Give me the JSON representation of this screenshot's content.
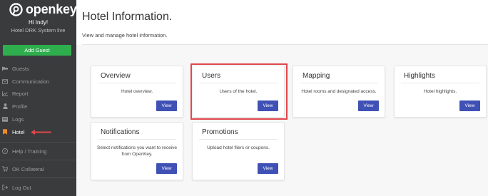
{
  "sidebar": {
    "logo_text": "openkey",
    "greeting": "Hi Indy!",
    "hotel_name": "Hotel DRK System live",
    "add_guest_label": "Add Guest",
    "items": [
      {
        "label": "Guests",
        "icon": "bed-icon"
      },
      {
        "label": "Communication",
        "icon": "envelope-icon"
      },
      {
        "label": "Report",
        "icon": "chart-icon"
      },
      {
        "label": "Profile",
        "icon": "user-icon"
      },
      {
        "label": "Logs",
        "icon": "list-icon"
      },
      {
        "label": "Hotel",
        "icon": "bookmark-icon",
        "active": true
      },
      {
        "label": "Help / Training",
        "icon": "question-icon"
      },
      {
        "label": "OK Collateral",
        "icon": "cart-icon"
      },
      {
        "label": "Log Out",
        "icon": "logout-icon"
      }
    ]
  },
  "main": {
    "title": "Hotel Information.",
    "subtitle": "View and manage hotel information."
  },
  "cards": [
    {
      "title": "Overview",
      "description": "Hotel overview.",
      "button": "View"
    },
    {
      "title": "Users",
      "description": "Users of the hotel.",
      "button": "View"
    },
    {
      "title": "Mapping",
      "description": "Hotel rooms and designated access.",
      "button": "View"
    },
    {
      "title": "Highlights",
      "description": "Hotel highlights.",
      "button": "View"
    },
    {
      "title": "Notifications",
      "description": "Select notifications you want to receive from OpenKey.",
      "button": "View"
    },
    {
      "title": "Promotions",
      "description": "Upload hotel fliers or coupons.",
      "button": "View"
    }
  ],
  "colors": {
    "sidebar_bg": "#3a3b3d",
    "add_guest": "#2fae4e",
    "view_button": "#3f51b5",
    "active_icon": "#f0892c",
    "annotation": "#e2474b"
  }
}
